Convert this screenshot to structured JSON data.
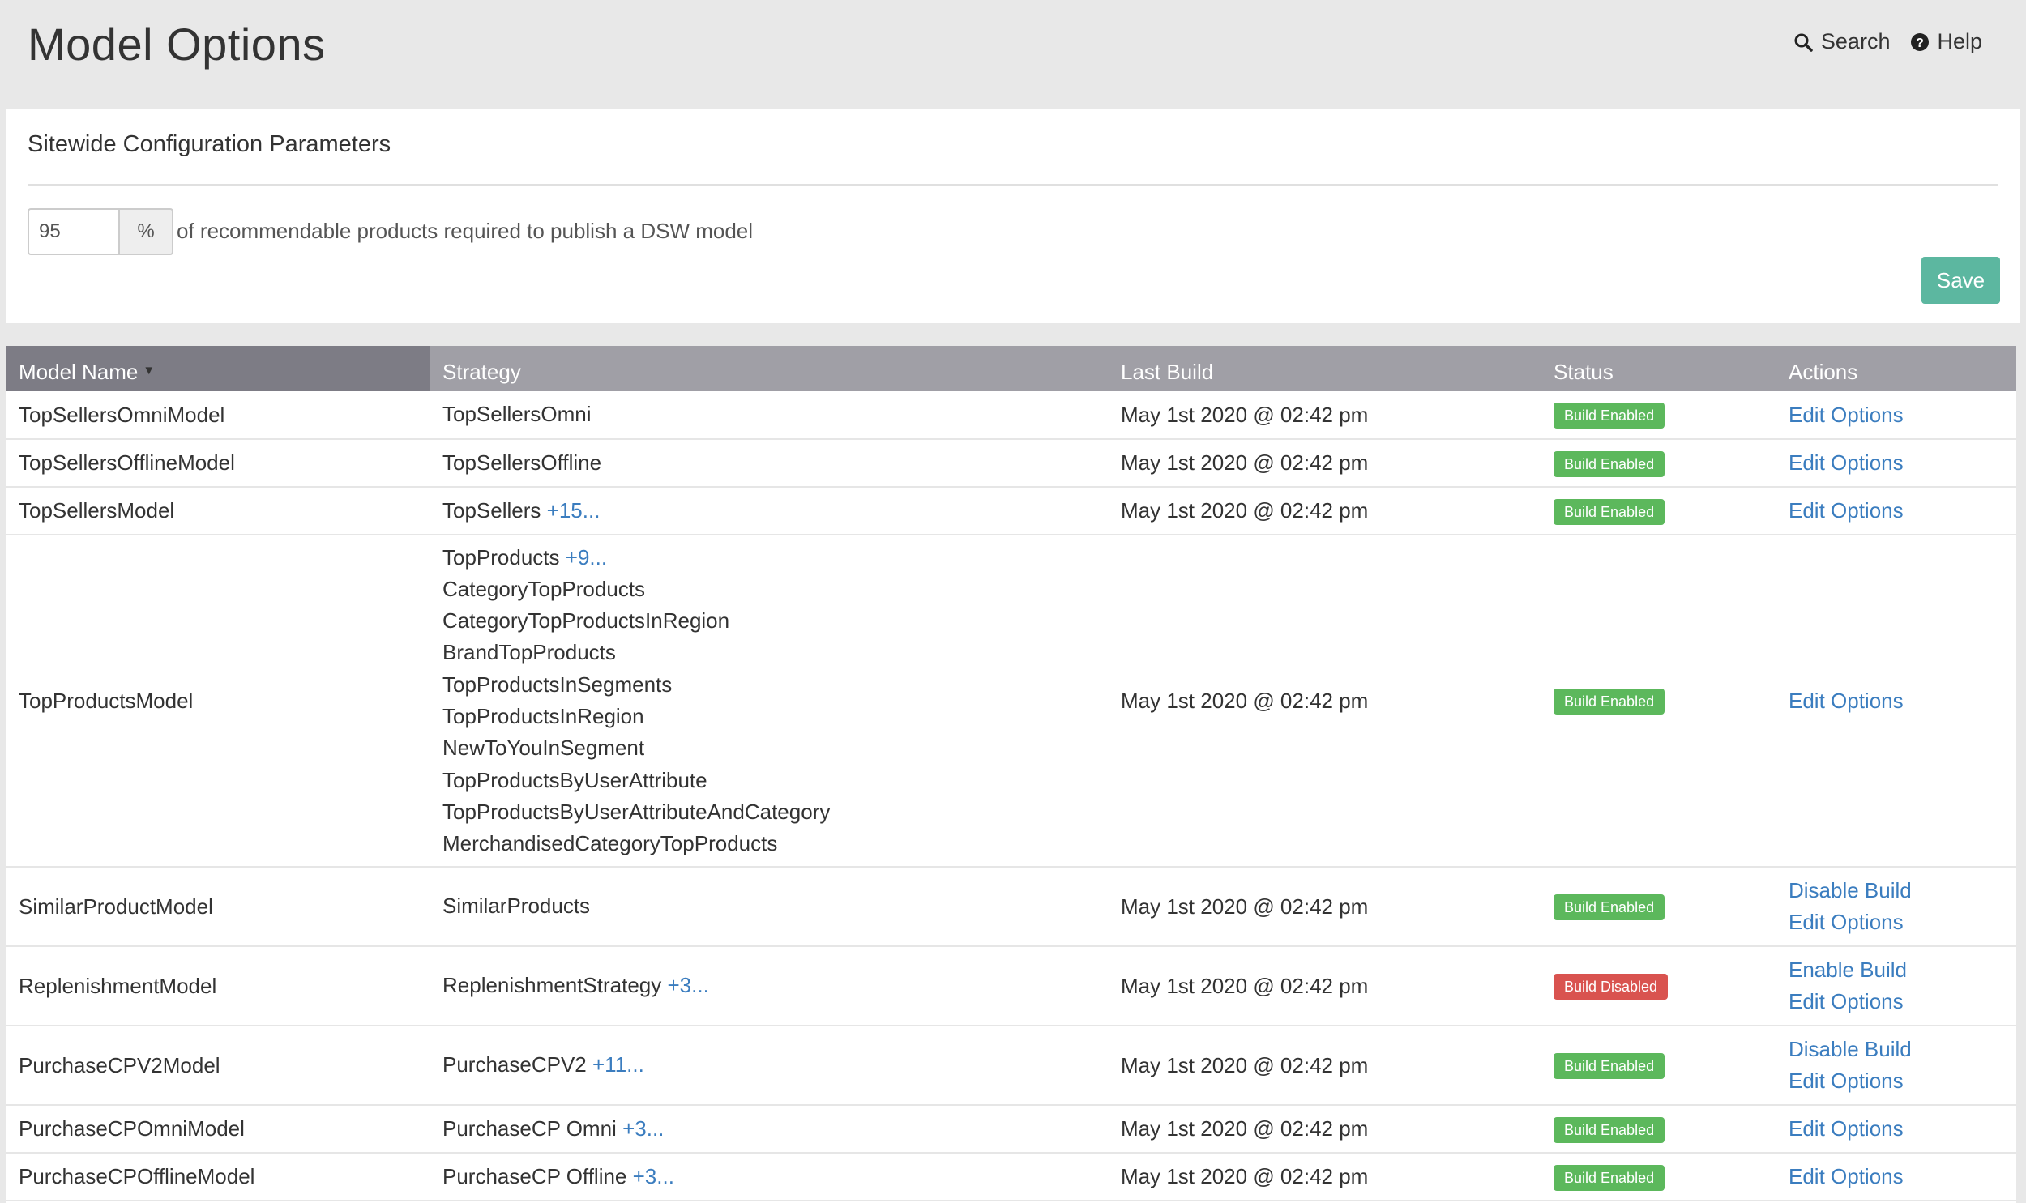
{
  "header": {
    "title": "Model Options",
    "search_label": "Search",
    "help_label": "Help"
  },
  "config": {
    "title": "Sitewide Configuration Parameters",
    "percent_value": "95",
    "percent_addon": "%",
    "description": "of recommendable products required to publish a DSW model",
    "save_label": "Save"
  },
  "table": {
    "columns": [
      "Model Name",
      "Strategy",
      "Last Build",
      "Status",
      "Actions"
    ],
    "sort_indicator": "▼",
    "rows": [
      {
        "name": "TopSellersOmniModel",
        "strategy": "TopSellersOmni",
        "more": "",
        "extra": [],
        "last_build": "May 1st 2020 @ 02:42 pm",
        "status": "Build Enabled",
        "status_type": "enabled",
        "toggle": "",
        "edit": "Edit Options"
      },
      {
        "name": "TopSellersOfflineModel",
        "strategy": "TopSellersOffline",
        "more": "",
        "extra": [],
        "last_build": "May 1st 2020 @ 02:42 pm",
        "status": "Build Enabled",
        "status_type": "enabled",
        "toggle": "",
        "edit": "Edit Options"
      },
      {
        "name": "TopSellersModel",
        "strategy": "TopSellers",
        "more": "+15...",
        "extra": [],
        "last_build": "May 1st 2020 @ 02:42 pm",
        "status": "Build Enabled",
        "status_type": "enabled",
        "toggle": "",
        "edit": "Edit Options"
      },
      {
        "name": "TopProductsModel",
        "strategy": "TopProducts",
        "more": "+9...",
        "extra": [
          "CategoryTopProducts",
          "CategoryTopProductsInRegion",
          "BrandTopProducts",
          "TopProductsInSegments",
          "TopProductsInRegion",
          "NewToYouInSegment",
          "TopProductsByUserAttribute",
          "TopProductsByUserAttributeAndCategory",
          "MerchandisedCategoryTopProducts"
        ],
        "last_build": "May 1st 2020 @ 02:42 pm",
        "status": "Build Enabled",
        "status_type": "enabled",
        "toggle": "",
        "edit": "Edit Options"
      },
      {
        "name": "SimilarProductModel",
        "strategy": "SimilarProducts",
        "more": "",
        "extra": [],
        "last_build": "May 1st 2020 @ 02:42 pm",
        "status": "Build Enabled",
        "status_type": "enabled",
        "toggle": "Disable Build",
        "edit": "Edit Options"
      },
      {
        "name": "ReplenishmentModel",
        "strategy": "ReplenishmentStrategy",
        "more": "+3...",
        "extra": [],
        "last_build": "May 1st 2020 @ 02:42 pm",
        "status": "Build Disabled",
        "status_type": "disabled",
        "toggle": "Enable Build",
        "edit": "Edit Options"
      },
      {
        "name": "PurchaseCPV2Model",
        "strategy": "PurchaseCPV2",
        "more": "+11...",
        "extra": [],
        "last_build": "May 1st 2020 @ 02:42 pm",
        "status": "Build Enabled",
        "status_type": "enabled",
        "toggle": "Disable Build",
        "edit": "Edit Options"
      },
      {
        "name": "PurchaseCPOmniModel",
        "strategy": "PurchaseCP Omni",
        "more": "+3...",
        "extra": [],
        "last_build": "May 1st 2020 @ 02:42 pm",
        "status": "Build Enabled",
        "status_type": "enabled",
        "toggle": "",
        "edit": "Edit Options"
      },
      {
        "name": "PurchaseCPOfflineModel",
        "strategy": "PurchaseCP Offline",
        "more": "+3...",
        "extra": [],
        "last_build": "May 1st 2020 @ 02:42 pm",
        "status": "Build Enabled",
        "status_type": "enabled",
        "toggle": "",
        "edit": "Edit Options"
      }
    ]
  },
  "colors": {
    "header_bg": "#e8e8e8",
    "table_header": "#a09fa6",
    "table_header_sorted": "#7d7c85",
    "link": "#3b7dbf",
    "save_button": "#5cb7a0",
    "badge_enabled": "#5cb85c",
    "badge_disabled": "#d9534f"
  }
}
